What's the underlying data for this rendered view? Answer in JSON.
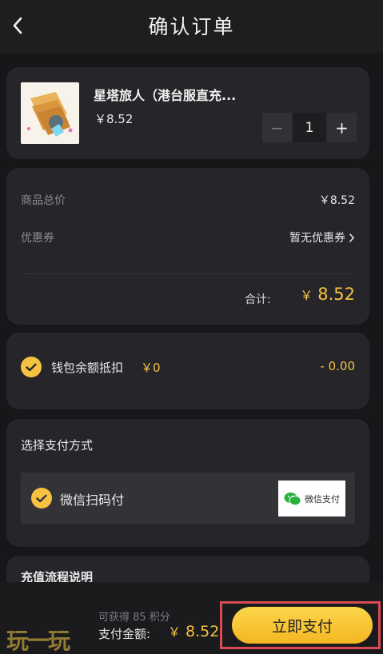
{
  "header": {
    "title": "确认订单"
  },
  "product": {
    "name": "星塔旅人（港台服直充...",
    "price": "￥8.52",
    "quantity": "1",
    "minus": "−",
    "plus": "+"
  },
  "price_summary": {
    "subtotal_label": "商品总价",
    "subtotal_value": "￥8.52",
    "coupon_label": "优惠券",
    "coupon_value": "暂无优惠券",
    "total_label": "合计:",
    "total_currency": "￥",
    "total_value": "8.52"
  },
  "wallet": {
    "label": "钱包余额抵扣",
    "amount": "￥0",
    "deduction": "- 0.00"
  },
  "payment": {
    "title": "选择支付方式",
    "option_label": "微信扫码付",
    "logo_text": "微信支付"
  },
  "recharge": {
    "title": "充值流程说明"
  },
  "footer": {
    "watermark": "玩一玩",
    "points": "可获得 85 积分",
    "amount_label": "支付金额:",
    "amount_currency": "￥",
    "amount_value": "8.52",
    "pay_button": "立即支付"
  },
  "colors": {
    "accent": "#f5c242",
    "background": "#17171a",
    "card": "#26262a",
    "highlight": "#d94b52"
  }
}
